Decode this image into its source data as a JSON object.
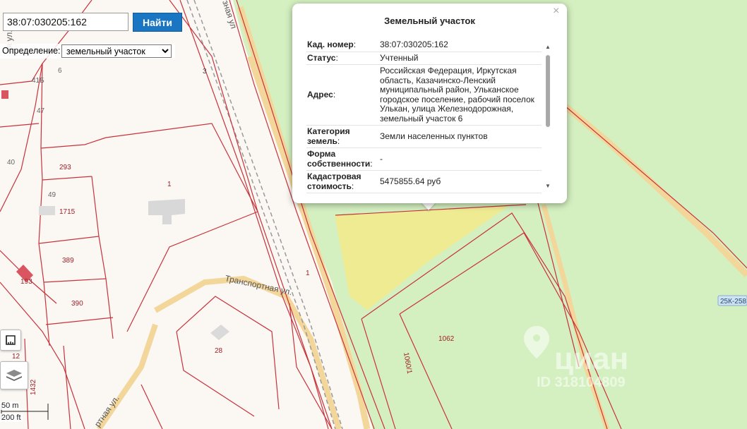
{
  "search": {
    "value": "38:07:030205:162",
    "button_label": "Найти"
  },
  "definition": {
    "label": "Определение:",
    "selected": "земельный участок"
  },
  "popup": {
    "title": "Земельный участок",
    "close": "×",
    "rows": [
      {
        "key": "Кад. номер",
        "value": "38:07:030205:162"
      },
      {
        "key": "Статус",
        "value": "Учтенный"
      },
      {
        "key": "Адрес",
        "value": "Российская Федерация, Иркутская область, Казачинско-Ленский муниципальный район, Ульканское городское поселение, рабочий поселок Улькан, улица Железнодорожная, земельный участок 6"
      },
      {
        "key": "Категория земель",
        "value": "Земли населенных пунктов"
      },
      {
        "key": "Форма собственности",
        "value": "-"
      },
      {
        "key": "Кадастровая стоимость",
        "value": "5475855.64 руб"
      }
    ]
  },
  "map": {
    "parcel_labels": [
      "41Б",
      "6",
      "47",
      "40",
      "293",
      "49",
      "1715",
      "1",
      "389",
      "390",
      "193",
      "12",
      "1432",
      "28",
      "1",
      "1062",
      "1060/1",
      "3"
    ],
    "street_labels": [
      "Транспортная ул.",
      "ртная ул.",
      "ая ул.",
      "зная ул"
    ],
    "road_badge": "25К-258",
    "watermark": {
      "brand": "циан",
      "id": "ID 318104809"
    }
  },
  "scale": {
    "metric": "50 m",
    "imperial": "200 ft"
  },
  "colors": {
    "parcel_border": "#c8323c",
    "forest": "#d4f0c0",
    "highlight": "#efeb93",
    "accent_button": "#1a76c3",
    "road": "#f2d69a"
  }
}
